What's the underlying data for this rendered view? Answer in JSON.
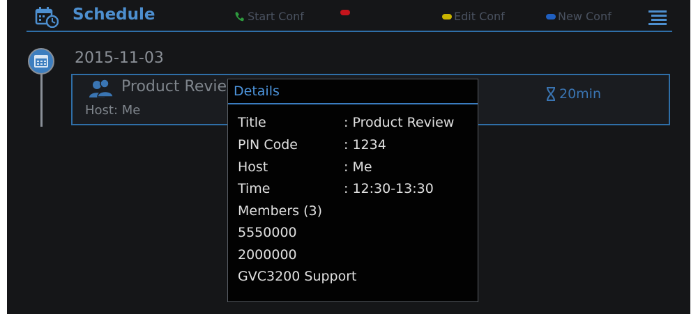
{
  "header": {
    "title": "Schedule",
    "icon": "calendar-clock-icon",
    "buttons": [
      {
        "label": "Start Conf",
        "indicator": "phone-icon",
        "color": "#2e9a3e"
      },
      {
        "label": "",
        "indicator": "red-key",
        "color": "#c4141c"
      },
      {
        "label": "Edit Conf",
        "indicator": "yellow-key",
        "color": "#c9b400"
      },
      {
        "label": "New Conf",
        "indicator": "blue-key",
        "color": "#1f5fc0"
      }
    ],
    "menu_icon": "menu-icon"
  },
  "timeline": {
    "date": "2015-11-03"
  },
  "meeting": {
    "title": "Product Revie",
    "host": "Host: Me",
    "duration": "20min"
  },
  "dialog": {
    "title": "Details",
    "fields": [
      {
        "label": "Title",
        "value": ": Product Review"
      },
      {
        "label": "PIN Code",
        "value": ": 1234"
      },
      {
        "label": "Host",
        "value": ": Me"
      },
      {
        "label": "Time",
        "value": ": 12:30-13:30"
      }
    ],
    "members_label": "Members (3)",
    "members": [
      "5550000",
      "2000000",
      "GVC3200 Support"
    ]
  },
  "colors": {
    "accent": "#4d8fcf",
    "background": "#151618",
    "dialog_background": "#020202"
  }
}
